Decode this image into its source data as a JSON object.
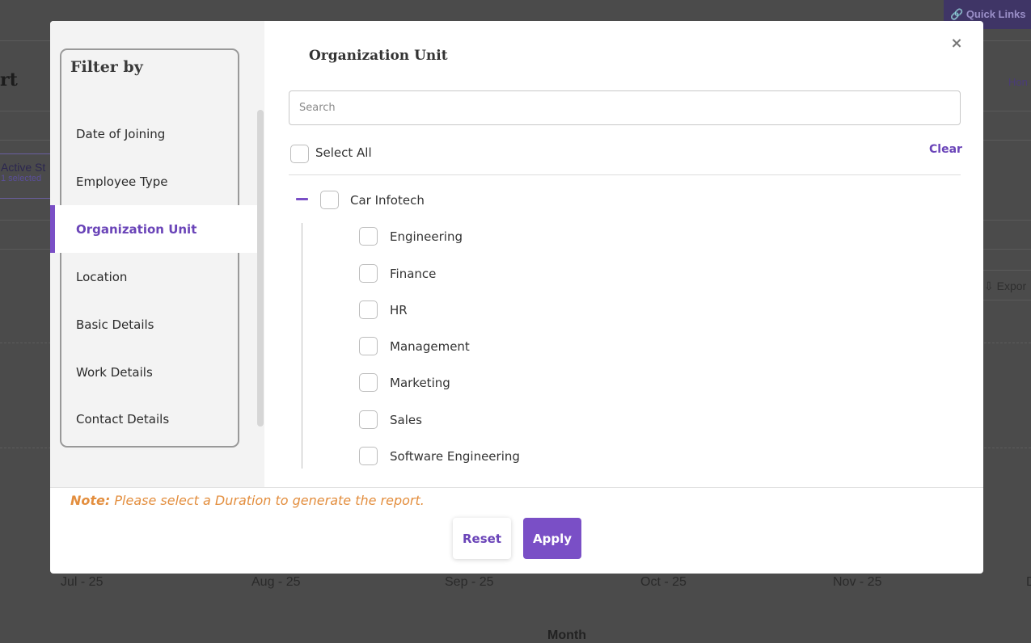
{
  "background": {
    "page_title": "rt",
    "home_link": "Hon",
    "quick_links": "Quick Links",
    "active_status": {
      "label": "Active St",
      "selected": "1 selected"
    },
    "export_label": "Expor",
    "x_axis": {
      "ticks": [
        "Jul - 25",
        "Aug - 25",
        "Sep - 25",
        "Oct - 25",
        "Nov - 25",
        "D"
      ],
      "title": "Month"
    }
  },
  "modal": {
    "sidebar": {
      "title": "Filter by",
      "items": [
        {
          "label": "Date of Joining",
          "active": false
        },
        {
          "label": "Employee Type",
          "active": false
        },
        {
          "label": "Organization Unit",
          "active": true
        },
        {
          "label": "Location",
          "active": false
        },
        {
          "label": "Basic Details",
          "active": false
        },
        {
          "label": "Work Details",
          "active": false
        },
        {
          "label": "Contact Details",
          "active": false
        }
      ]
    },
    "panel": {
      "title": "Organization Unit",
      "close": "×",
      "search_placeholder": "Search",
      "select_all": "Select All",
      "clear": "Clear",
      "tree": {
        "root": "Car Infotech",
        "children": [
          "Engineering",
          "Finance",
          "HR",
          "Management",
          "Marketing",
          "Sales",
          "Software Engineering"
        ]
      }
    },
    "footer": {
      "note_label": "Note:",
      "note_text": "Please select a Duration to generate the report.",
      "reset": "Reset",
      "apply": "Apply"
    }
  },
  "colors": {
    "accent": "#7a4fc6",
    "note": "#e38e3e"
  }
}
